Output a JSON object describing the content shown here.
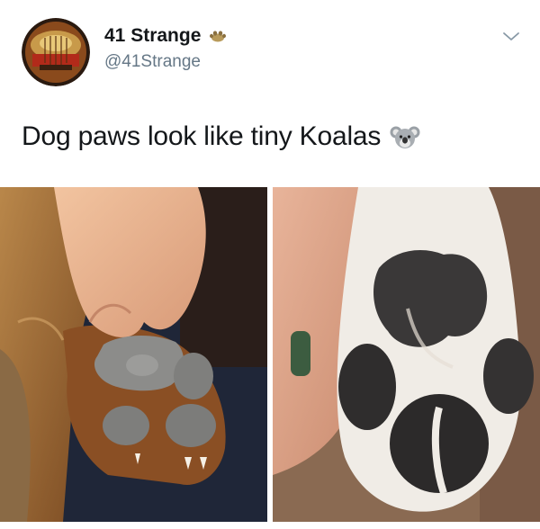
{
  "author": {
    "display_name": "41 Strange",
    "handle": "@41Strange"
  },
  "tweet": {
    "text": "Dog paws look like tiny Koalas"
  },
  "icons": {
    "verified_badge": "paw-badge-icon",
    "menu": "chevron-down-icon",
    "emoji": "koala-emoji"
  },
  "colors": {
    "text_primary": "#14171a",
    "text_secondary": "#657786",
    "background": "#ffffff"
  }
}
